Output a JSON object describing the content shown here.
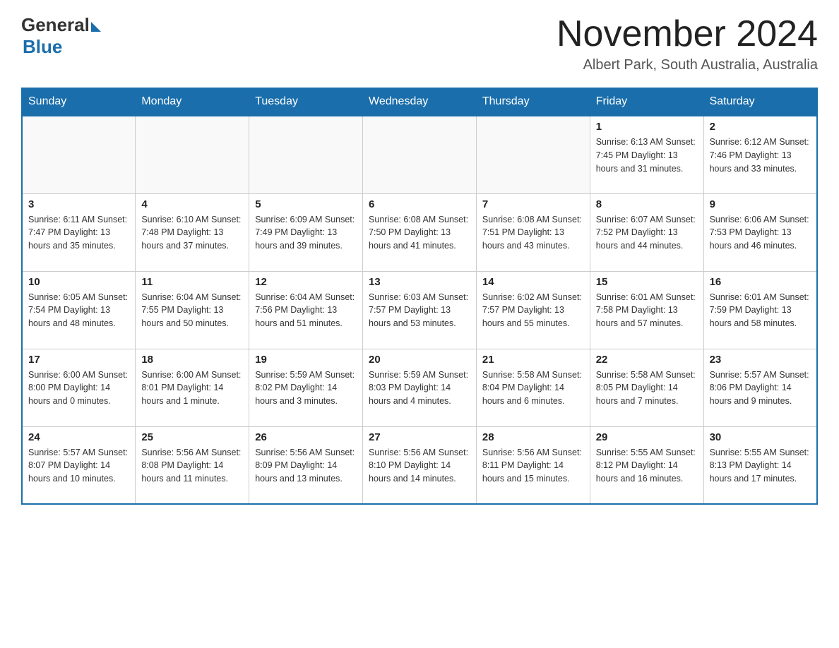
{
  "header": {
    "logo_general": "General",
    "logo_blue": "Blue",
    "title": "November 2024",
    "location": "Albert Park, South Australia, Australia"
  },
  "days_of_week": [
    "Sunday",
    "Monday",
    "Tuesday",
    "Wednesday",
    "Thursday",
    "Friday",
    "Saturday"
  ],
  "weeks": [
    [
      {
        "day": "",
        "info": ""
      },
      {
        "day": "",
        "info": ""
      },
      {
        "day": "",
        "info": ""
      },
      {
        "day": "",
        "info": ""
      },
      {
        "day": "",
        "info": ""
      },
      {
        "day": "1",
        "info": "Sunrise: 6:13 AM\nSunset: 7:45 PM\nDaylight: 13 hours and 31 minutes."
      },
      {
        "day": "2",
        "info": "Sunrise: 6:12 AM\nSunset: 7:46 PM\nDaylight: 13 hours and 33 minutes."
      }
    ],
    [
      {
        "day": "3",
        "info": "Sunrise: 6:11 AM\nSunset: 7:47 PM\nDaylight: 13 hours and 35 minutes."
      },
      {
        "day": "4",
        "info": "Sunrise: 6:10 AM\nSunset: 7:48 PM\nDaylight: 13 hours and 37 minutes."
      },
      {
        "day": "5",
        "info": "Sunrise: 6:09 AM\nSunset: 7:49 PM\nDaylight: 13 hours and 39 minutes."
      },
      {
        "day": "6",
        "info": "Sunrise: 6:08 AM\nSunset: 7:50 PM\nDaylight: 13 hours and 41 minutes."
      },
      {
        "day": "7",
        "info": "Sunrise: 6:08 AM\nSunset: 7:51 PM\nDaylight: 13 hours and 43 minutes."
      },
      {
        "day": "8",
        "info": "Sunrise: 6:07 AM\nSunset: 7:52 PM\nDaylight: 13 hours and 44 minutes."
      },
      {
        "day": "9",
        "info": "Sunrise: 6:06 AM\nSunset: 7:53 PM\nDaylight: 13 hours and 46 minutes."
      }
    ],
    [
      {
        "day": "10",
        "info": "Sunrise: 6:05 AM\nSunset: 7:54 PM\nDaylight: 13 hours and 48 minutes."
      },
      {
        "day": "11",
        "info": "Sunrise: 6:04 AM\nSunset: 7:55 PM\nDaylight: 13 hours and 50 minutes."
      },
      {
        "day": "12",
        "info": "Sunrise: 6:04 AM\nSunset: 7:56 PM\nDaylight: 13 hours and 51 minutes."
      },
      {
        "day": "13",
        "info": "Sunrise: 6:03 AM\nSunset: 7:57 PM\nDaylight: 13 hours and 53 minutes."
      },
      {
        "day": "14",
        "info": "Sunrise: 6:02 AM\nSunset: 7:57 PM\nDaylight: 13 hours and 55 minutes."
      },
      {
        "day": "15",
        "info": "Sunrise: 6:01 AM\nSunset: 7:58 PM\nDaylight: 13 hours and 57 minutes."
      },
      {
        "day": "16",
        "info": "Sunrise: 6:01 AM\nSunset: 7:59 PM\nDaylight: 13 hours and 58 minutes."
      }
    ],
    [
      {
        "day": "17",
        "info": "Sunrise: 6:00 AM\nSunset: 8:00 PM\nDaylight: 14 hours and 0 minutes."
      },
      {
        "day": "18",
        "info": "Sunrise: 6:00 AM\nSunset: 8:01 PM\nDaylight: 14 hours and 1 minute."
      },
      {
        "day": "19",
        "info": "Sunrise: 5:59 AM\nSunset: 8:02 PM\nDaylight: 14 hours and 3 minutes."
      },
      {
        "day": "20",
        "info": "Sunrise: 5:59 AM\nSunset: 8:03 PM\nDaylight: 14 hours and 4 minutes."
      },
      {
        "day": "21",
        "info": "Sunrise: 5:58 AM\nSunset: 8:04 PM\nDaylight: 14 hours and 6 minutes."
      },
      {
        "day": "22",
        "info": "Sunrise: 5:58 AM\nSunset: 8:05 PM\nDaylight: 14 hours and 7 minutes."
      },
      {
        "day": "23",
        "info": "Sunrise: 5:57 AM\nSunset: 8:06 PM\nDaylight: 14 hours and 9 minutes."
      }
    ],
    [
      {
        "day": "24",
        "info": "Sunrise: 5:57 AM\nSunset: 8:07 PM\nDaylight: 14 hours and 10 minutes."
      },
      {
        "day": "25",
        "info": "Sunrise: 5:56 AM\nSunset: 8:08 PM\nDaylight: 14 hours and 11 minutes."
      },
      {
        "day": "26",
        "info": "Sunrise: 5:56 AM\nSunset: 8:09 PM\nDaylight: 14 hours and 13 minutes."
      },
      {
        "day": "27",
        "info": "Sunrise: 5:56 AM\nSunset: 8:10 PM\nDaylight: 14 hours and 14 minutes."
      },
      {
        "day": "28",
        "info": "Sunrise: 5:56 AM\nSunset: 8:11 PM\nDaylight: 14 hours and 15 minutes."
      },
      {
        "day": "29",
        "info": "Sunrise: 5:55 AM\nSunset: 8:12 PM\nDaylight: 14 hours and 16 minutes."
      },
      {
        "day": "30",
        "info": "Sunrise: 5:55 AM\nSunset: 8:13 PM\nDaylight: 14 hours and 17 minutes."
      }
    ]
  ]
}
